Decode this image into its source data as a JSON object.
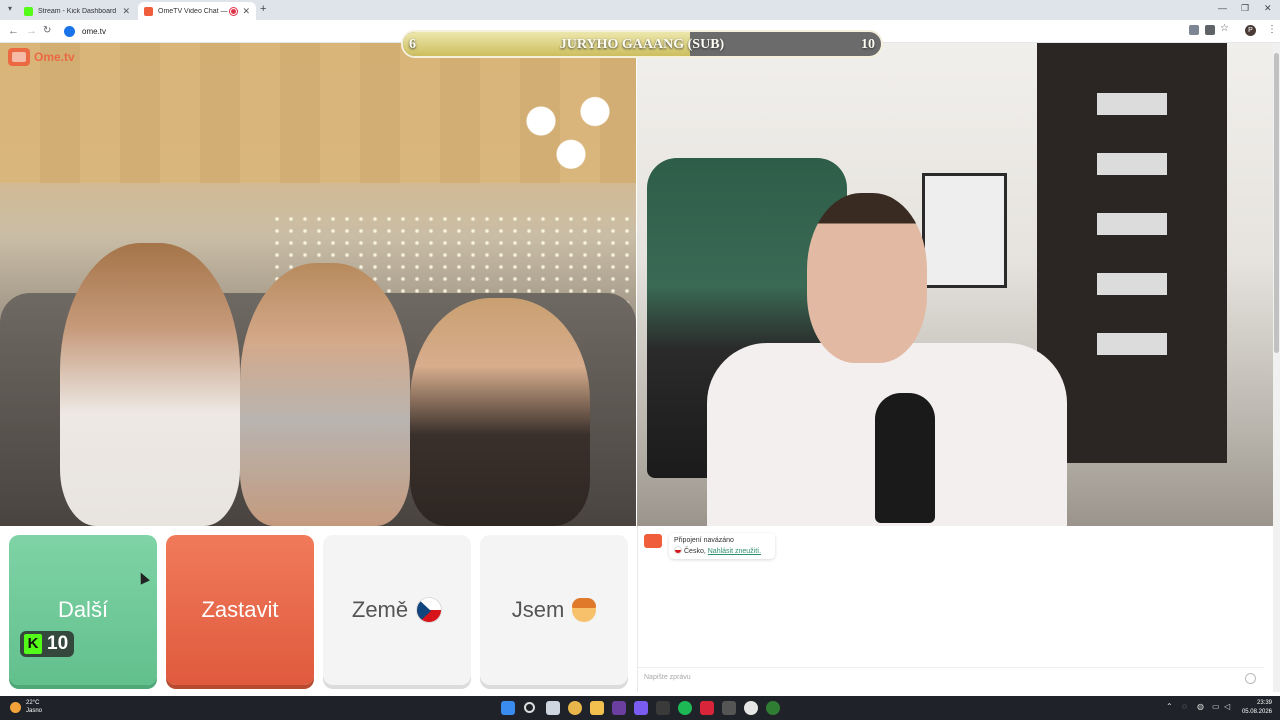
{
  "browser": {
    "tabs": [
      {
        "title": "Stream - Kick Dashboard",
        "favicon_color": "#53fc18",
        "active": false
      },
      {
        "title": "OmeTV Video Chat — Ome",
        "favicon_color": "#f05d3a",
        "active": true
      }
    ],
    "new_tab_label": "+",
    "url": "ome.tv"
  },
  "ometv": {
    "logo": "Ome.tv"
  },
  "subgoal": {
    "title": "JURYHO GAAANG (SUB)",
    "current": "6",
    "target": "10",
    "progress": 0.6
  },
  "controls": {
    "next_label": "Další",
    "stop_label": "Zastavit",
    "country_label": "Země",
    "country_flag_icon": "czech-flag-icon",
    "gender_label": "Jsem",
    "gender_icon": "boy-emoji-icon",
    "kick_count": "10"
  },
  "chat": {
    "system_message_title": "Připojení navázáno",
    "country": "Česko,",
    "report_link": "Nahlásit zneužití.",
    "input_placeholder": "Napište zprávu"
  },
  "taskbar": {
    "temperature": "22°C",
    "weather_text": "Jasno",
    "time": "23:39",
    "date": "05.08.2026"
  },
  "colors": {
    "next_button": "#6ccb97",
    "stop_button": "#e8664a",
    "accent_green": "#53fc18",
    "subgoal_fill": "#dcd07f"
  }
}
